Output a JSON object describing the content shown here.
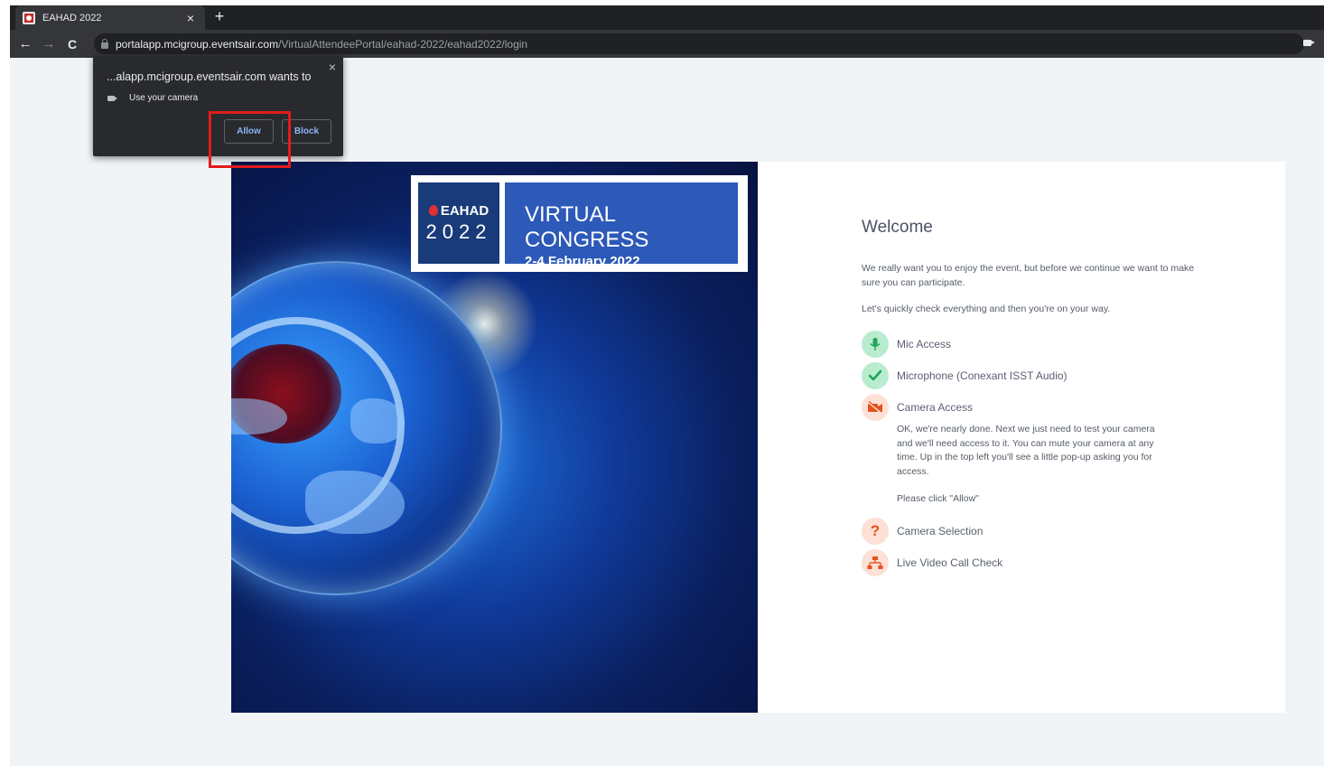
{
  "browser": {
    "tab_title": "EAHAD 2022",
    "tab_close": "×",
    "new_tab": "+",
    "back": "←",
    "forward": "→",
    "reload": "C",
    "url_host": "portalapp.mcigroup.eventsair.com",
    "url_path": "/VirtualAttendeePortal/eahad-2022/eahad2022/login"
  },
  "permission_popup": {
    "title": "...alapp.mcigroup.eventsair.com wants to",
    "close": "×",
    "permission": "Use your camera",
    "allow_label": "Allow",
    "block_label": "Block"
  },
  "banner": {
    "logo_text": "EAHAD",
    "year": "2022",
    "title": "VIRTUAL CONGRESS",
    "dates": "2-4 February 2022"
  },
  "checklist": {
    "heading": "Welcome",
    "intro": "We really want you to enjoy the event, but before we continue we want to make sure you can participate.",
    "intro2": "Let's quickly check everything and then you're on your way.",
    "steps": [
      {
        "label": "Mic Access",
        "icon": "microphone-icon",
        "status": "done"
      },
      {
        "label": "Microphone (Conexant ISST Audio)",
        "icon": "check-icon",
        "status": "done"
      },
      {
        "label": "Camera Access",
        "icon": "camera-off-icon",
        "status": "current"
      },
      {
        "label": "Camera Selection",
        "icon": "question-icon",
        "status": "pending"
      },
      {
        "label": "Live Video Call Check",
        "icon": "network-icon",
        "status": "pending"
      }
    ],
    "camera_description": "OK, we're nearly done. Next we just need to test your camera and we'll need access to it. You can mute your camera at any time. Up in the top left you'll see a little pop-up asking you for access.",
    "camera_note": "Please click \"Allow\""
  },
  "colors": {
    "done_bg": "#b9ecce",
    "done_fg": "#1fa55b",
    "pending_bg": "#fde0d6",
    "pending_fg": "#e8501c",
    "highlight": "#e31b1b"
  }
}
